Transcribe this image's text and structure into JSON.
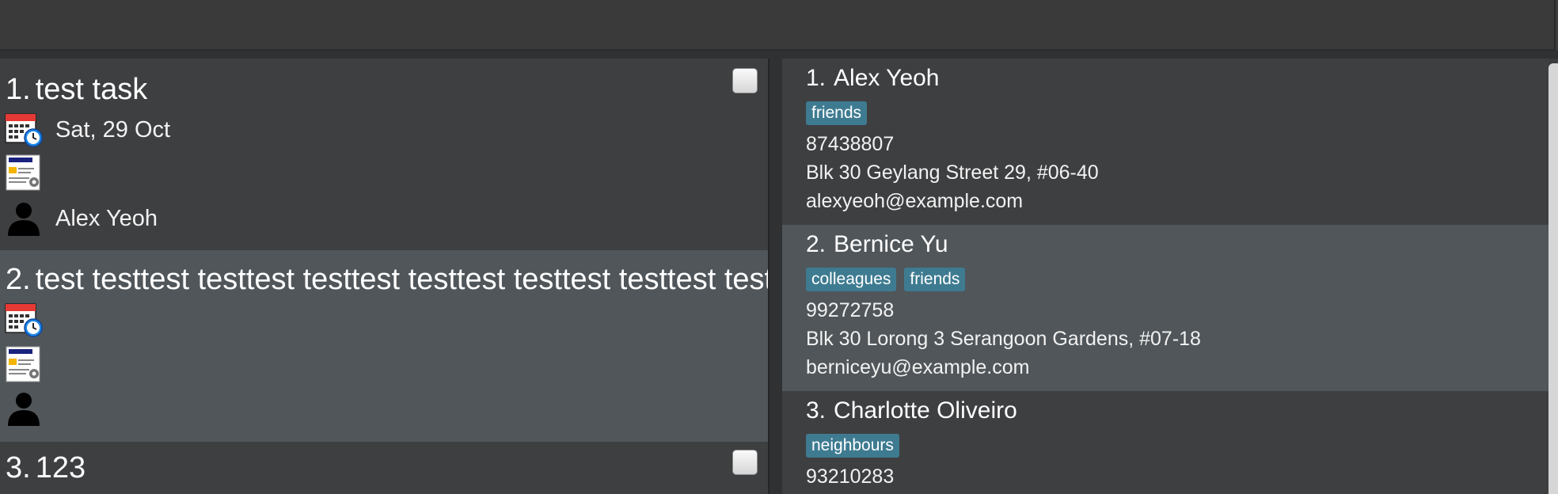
{
  "tasks": [
    {
      "index": "1.",
      "title": "test task",
      "date": "Sat, 29 Oct",
      "project": "",
      "assignee": "Alex Yeoh",
      "has_checkbox": true
    },
    {
      "index": "2.",
      "title": "test testtest testtest testtest testtest testtest testtest testtest",
      "date": "",
      "project": "",
      "assignee": "",
      "has_checkbox": false
    },
    {
      "index": "3.",
      "title": "123",
      "has_checkbox": true
    }
  ],
  "persons": [
    {
      "index": "1.",
      "name": "Alex Yeoh",
      "tags": [
        "friends"
      ],
      "phone": "87438807",
      "address": "Blk 30 Geylang Street 29, #06-40",
      "email": "alexyeoh@example.com"
    },
    {
      "index": "2.",
      "name": "Bernice Yu",
      "tags": [
        "colleagues",
        "friends"
      ],
      "phone": "99272758",
      "address": "Blk 30 Lorong 3 Serangoon Gardens, #07-18",
      "email": "berniceyu@example.com"
    },
    {
      "index": "3.",
      "name": "Charlotte Oliveiro",
      "tags": [
        "neighbours"
      ],
      "phone": "93210283"
    }
  ],
  "icons": {
    "date": "calendar-clock-icon",
    "project": "project-document-icon",
    "assignee": "person-icon"
  },
  "colors": {
    "tag": "#3e7b91",
    "card_odd": "#3e3f41",
    "card_even": "#50565a"
  }
}
